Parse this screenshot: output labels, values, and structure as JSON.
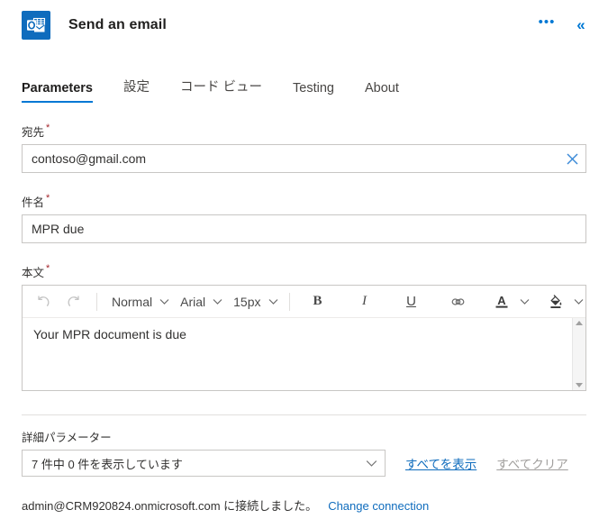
{
  "header": {
    "app_icon": "outlook-icon",
    "title": "Send an email",
    "more_label": "•••",
    "collapse_label": "«",
    "accent": "#0078d4",
    "icon_bg": "#0f6cbd"
  },
  "tabs": [
    {
      "label": "Parameters",
      "active": true
    },
    {
      "label": "設定",
      "active": false
    },
    {
      "label": "コード ビュー",
      "active": false
    },
    {
      "label": "Testing",
      "active": false
    },
    {
      "label": "About",
      "active": false
    }
  ],
  "fields": {
    "to": {
      "label": "宛先",
      "required_mark": "*",
      "value": "contoso@gmail.com",
      "clear_icon": "close-icon"
    },
    "subject": {
      "label": "件名",
      "required_mark": "*",
      "value": "MPR due"
    },
    "body": {
      "label": "本文",
      "required_mark": "*",
      "value": "Your MPR document is due"
    }
  },
  "editor_toolbar": {
    "undo": {
      "icon": "undo-icon",
      "label": "↺"
    },
    "redo": {
      "icon": "redo-icon",
      "label": "↻"
    },
    "style": "Normal",
    "font": "Arial",
    "size": "15px",
    "bold": "B",
    "italic": "I",
    "underline": "U",
    "link_icon": "link-icon",
    "font_color": "A",
    "highlight_icon": "highlight-icon"
  },
  "advanced": {
    "label": "詳細パラメーター",
    "select_value": "7 件中 0 件を表示しています",
    "show_all": "すべてを表示",
    "clear_all": "すべてクリア"
  },
  "footer": {
    "status": "admin@CRM920824.onmicrosoft.com に接続しました。",
    "change_connection": "Change connection"
  }
}
